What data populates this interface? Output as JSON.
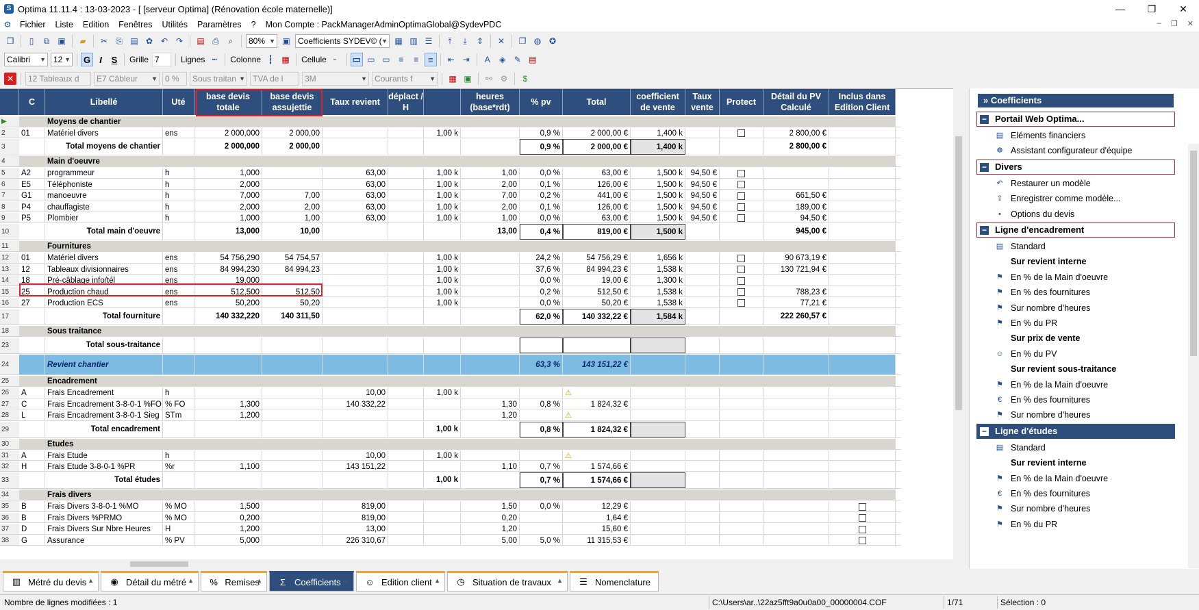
{
  "window": {
    "title": "Optima 11.11.4 : 13-03-2023 - [ [serveur Optima] (Rénovation école maternelle)]",
    "minimize": "—",
    "maximize": "❐",
    "close": "✕"
  },
  "menu": {
    "items": [
      "Fichier",
      "Liste",
      "Edition",
      "Fenêtres",
      "Utilités",
      "Paramètres",
      "?"
    ],
    "account": "Mon Compte : PackManagerAdminOptimaGlobal@SydevPDC",
    "mdi": [
      "–",
      "❐",
      "✕"
    ]
  },
  "toolbar1": {
    "zoom": "80%",
    "coeff_combo": "Coefficients  SYDEV© ("
  },
  "toolbar2": {
    "font": "Calibri",
    "size": "12",
    "bold": "G",
    "italic": "I",
    "strike": "S",
    "grille_label": "Grille",
    "grille_value": "7",
    "lignes_label": "Lignes",
    "colonne_label": "Colonne",
    "cellule_label": "Cellule"
  },
  "toolbar3": {
    "c1": "12  Tableaux d",
    "c2": "E7  Câbleur",
    "c3": "0 %",
    "c4": "Sous traitan",
    "c5": "TVA de l",
    "c6": "3M",
    "c7": "Courants f"
  },
  "columns": [
    {
      "key": "c",
      "label": "C"
    },
    {
      "key": "libelle",
      "label": "Libellé"
    },
    {
      "key": "ute",
      "label": "Uté"
    },
    {
      "key": "bdt",
      "label": "base devis totale"
    },
    {
      "key": "bda",
      "label": "base devis assujettie"
    },
    {
      "key": "tr",
      "label": "Taux revient"
    },
    {
      "key": "dep",
      "label": "déplact / H"
    },
    {
      "key": "k",
      "label": ""
    },
    {
      "key": "h",
      "label": "heures (base*rdt)"
    },
    {
      "key": "pv",
      "label": "% pv"
    },
    {
      "key": "tot",
      "label": "Total"
    },
    {
      "key": "cv",
      "label": "coefficient de vente"
    },
    {
      "key": "tv",
      "label": "Taux vente"
    },
    {
      "key": "prot",
      "label": "Protect"
    },
    {
      "key": "dpv",
      "label": "Détail du PV Calculé"
    },
    {
      "key": "inc",
      "label": "Inclus dans Edition Client"
    }
  ],
  "rows": [
    {
      "n": "",
      "type": "sec",
      "libelle": "Moyens de chantier"
    },
    {
      "n": "2",
      "c": "01",
      "libelle": "Matériel divers",
      "ute": "ens",
      "bdt": "2 000,000",
      "bda": "2 000,00",
      "k": "1,00 k",
      "pv": "0,9 %",
      "tot": "2 000,00 €",
      "cv": "1,400 k",
      "prot": true,
      "dpv": "2 800,00 €"
    },
    {
      "n": "3",
      "type": "tot",
      "libelle": "Total moyens de chantier",
      "bdt": "2 000,000",
      "bda": "2 000,00",
      "pv": "0,9 %",
      "tot": "2 000,00 €",
      "cv": "1,400 k",
      "dpv": "2 800,00 €"
    },
    {
      "n": "4",
      "type": "sec",
      "libelle": "Main d'oeuvre"
    },
    {
      "n": "5",
      "c": "A2",
      "libelle": "programmeur",
      "ute": "h",
      "bdt": "1,000",
      "tr": "63,00",
      "k": "1,00 k",
      "h": "1,00",
      "pv": "0,0 %",
      "tot": "63,00 €",
      "cv": "1,500 k",
      "tv": "94,50 €",
      "prot": true
    },
    {
      "n": "6",
      "c": "E5",
      "libelle": "Téléphoniste",
      "ute": "h",
      "bdt": "2,000",
      "tr": "63,00",
      "k": "1,00 k",
      "h": "2,00",
      "pv": "0,1 %",
      "tot": "126,00 €",
      "cv": "1,500 k",
      "tv": "94,50 €",
      "prot": true
    },
    {
      "n": "7",
      "c": "G1",
      "libelle": "manoeuvre",
      "ute": "h",
      "bdt": "7,000",
      "bda": "7,00",
      "tr": "63,00",
      "k": "1,00 k",
      "h": "7,00",
      "pv": "0,2 %",
      "tot": "441,00 €",
      "cv": "1,500 k",
      "tv": "94,50 €",
      "prot": true,
      "dpv": "661,50 €"
    },
    {
      "n": "8",
      "c": "P4",
      "libelle": "chauffagiste",
      "ute": "h",
      "bdt": "2,000",
      "bda": "2,00",
      "tr": "63,00",
      "k": "1,00 k",
      "h": "2,00",
      "pv": "0,1 %",
      "tot": "126,00 €",
      "cv": "1,500 k",
      "tv": "94,50 €",
      "prot": true,
      "dpv": "189,00 €"
    },
    {
      "n": "9",
      "c": "P5",
      "libelle": "Plombier",
      "ute": "h",
      "bdt": "1,000",
      "bda": "1,00",
      "tr": "63,00",
      "k": "1,00 k",
      "h": "1,00",
      "pv": "0,0 %",
      "tot": "63,00 €",
      "cv": "1,500 k",
      "tv": "94,50 €",
      "prot": true,
      "dpv": "94,50 €"
    },
    {
      "n": "10",
      "type": "tot",
      "libelle": "Total main d'oeuvre",
      "bdt": "13,000",
      "bda": "10,00",
      "h": "13,00",
      "pv": "0,4 %",
      "tot": "819,00 €",
      "cv": "1,500 k",
      "dpv": "945,00 €"
    },
    {
      "n": "11",
      "type": "sec",
      "libelle": "Fournitures"
    },
    {
      "n": "12",
      "c": "01",
      "libelle": "Matériel divers",
      "ute": "ens",
      "bdt": "54 756,290",
      "bda": "54 754,57",
      "k": "1,00 k",
      "pv": "24,2 %",
      "tot": "54 756,29 €",
      "cv": "1,656 k",
      "prot": true,
      "dpv": "90 673,19 €"
    },
    {
      "n": "13",
      "c": "12",
      "libelle": "Tableaux divisionnaires",
      "ute": "ens",
      "bdt": "84 994,230",
      "bda": "84 994,23",
      "k": "1,00 k",
      "pv": "37,6 %",
      "tot": "84 994,23 €",
      "cv": "1,538 k",
      "prot": true,
      "dpv": "130 721,94 €"
    },
    {
      "n": "14",
      "c": "18",
      "libelle": "Pré-câblage info/tél",
      "ute": "ens",
      "bdt": "19,000",
      "k": "1,00 k",
      "pv": "0,0 %",
      "tot": "19,00 €",
      "cv": "1,300 k",
      "prot": true
    },
    {
      "n": "15",
      "c": "25",
      "libelle": "Production chaud",
      "ute": "ens",
      "bdt": "512,500",
      "bda": "512,50",
      "k": "1,00 k",
      "pv": "0,2 %",
      "tot": "512,50 €",
      "cv": "1,538 k",
      "prot": true,
      "dpv": "788,23 €"
    },
    {
      "n": "16",
      "c": "27",
      "libelle": "Production ECS",
      "ute": "ens",
      "bdt": "50,200",
      "bda": "50,20",
      "k": "1,00 k",
      "pv": "0,0 %",
      "tot": "50,20 €",
      "cv": "1,538 k",
      "prot": true,
      "dpv": "77,21 €"
    },
    {
      "n": "17",
      "type": "tot",
      "libelle": "Total fourniture",
      "bdt": "140 332,220",
      "bda": "140 311,50",
      "pv": "62,0 %",
      "tot": "140 332,22 €",
      "cv": "1,584 k",
      "dpv": "222 260,57 €"
    },
    {
      "n": "18",
      "type": "sec",
      "libelle": "Sous traitance"
    },
    {
      "n": "23",
      "type": "tot",
      "libelle": "Total sous-traitance"
    },
    {
      "n": "24",
      "type": "rev",
      "libelle": "Revient chantier",
      "pv": "63,3 %",
      "tot": "143 151,22 €"
    },
    {
      "n": "25",
      "type": "sec",
      "libelle": "Encadrement"
    },
    {
      "n": "26",
      "c": "A",
      "libelle": "Frais Encadrement",
      "ute": "h",
      "tr": "10,00",
      "k": "1,00 k",
      "warn": true
    },
    {
      "n": "27",
      "c": "C",
      "libelle": "Frais Encadrement 3-8-0-1 %FO",
      "ute": "% FO",
      "bdt": "1,300",
      "tr": "140 332,22",
      "h": "1,30",
      "pv": "0,8 %",
      "tot": "1 824,32 €"
    },
    {
      "n": "28",
      "c": "L",
      "libelle": "Frais Encadrement 3-8-0-1 Sieg",
      "ute": "STm",
      "bdt": "1,200",
      "h": "1,20",
      "warn": true
    },
    {
      "n": "29",
      "type": "tot",
      "libelle": "Total encadrement",
      "k": "1,00 k",
      "pv": "0,8 %",
      "tot": "1 824,32 €"
    },
    {
      "n": "30",
      "type": "sec",
      "libelle": "Etudes"
    },
    {
      "n": "31",
      "c": "A",
      "libelle": "Frais Etude",
      "ute": "h",
      "tr": "10,00",
      "k": "1,00 k",
      "warn": true
    },
    {
      "n": "32",
      "c": "H",
      "libelle": "Frais Etude 3-8-0-1 %PR",
      "ute": "%r",
      "bdt": "1,100",
      "tr": "143 151,22",
      "h": "1,10",
      "pv": "0,7 %",
      "tot": "1 574,66 €"
    },
    {
      "n": "33",
      "type": "tot",
      "libelle": "Total études",
      "k": "1,00 k",
      "pv": "0,7 %",
      "tot": "1 574,66 €"
    },
    {
      "n": "34",
      "type": "sec",
      "libelle": "Frais divers"
    },
    {
      "n": "35",
      "c": "B",
      "libelle": "Frais Divers 3-8-0-1 %MO",
      "ute": "% MO",
      "bdt": "1,500",
      "tr": "819,00",
      "h": "1,50",
      "pv": "0,0 %",
      "tot": "12,29 €",
      "inc": true
    },
    {
      "n": "36",
      "c": "B",
      "libelle": "Frais Divers %PRMO",
      "ute": "% MO",
      "bdt": "0,200",
      "tr": "819,00",
      "h": "0,20",
      "tot": "1,64 €",
      "inc": true
    },
    {
      "n": "37",
      "c": "D",
      "libelle": "Frais Divers Sur Nbre Heures",
      "ute": "H",
      "bdt": "1,200",
      "tr": "13,00",
      "h": "1,20",
      "tot": "15,60 €",
      "inc": true
    },
    {
      "n": "38",
      "c": "G",
      "libelle": "Assurance",
      "ute": "% PV",
      "bdt": "5,000",
      "tr": "226 310,67",
      "h": "5,00",
      "pv": "5,0 %",
      "tot": "11 315,53 €",
      "inc": true
    }
  ],
  "panel": {
    "title": "Coefficients",
    "groups": [
      {
        "label": "Portail Web Optima...",
        "items": [
          {
            "icon": "coins-icon",
            "glyph": "▤",
            "label": "Eléments financiers"
          },
          {
            "icon": "team-icon",
            "glyph": "☸",
            "label": "Assistant configurateur d'équipe"
          }
        ]
      },
      {
        "label": "Divers",
        "items": [
          {
            "icon": "restore-icon",
            "glyph": "↶",
            "label": "Restaurer un modèle"
          },
          {
            "icon": "save-model-icon",
            "glyph": "⇪",
            "label": "Enregistrer comme modèle..."
          },
          {
            "icon": "options-icon",
            "glyph": "•",
            "label": "Options du devis"
          }
        ]
      },
      {
        "label": "Ligne d'encadrement",
        "items": [
          {
            "icon": "standard-icon",
            "glyph": "▤",
            "label": "Standard"
          },
          {
            "icon": "",
            "glyph": "",
            "label": "Sur revient interne",
            "bold": true
          },
          {
            "icon": "worker-icon",
            "glyph": "⚑",
            "label": "En % de la Main d'oeuvre"
          },
          {
            "icon": "worker-icon",
            "glyph": "⚑",
            "label": "En % des fournitures"
          },
          {
            "icon": "worker-icon",
            "glyph": "⚑",
            "label": "Sur nombre d'heures"
          },
          {
            "icon": "worker-icon",
            "glyph": "⚑",
            "label": "En % du PR"
          },
          {
            "icon": "",
            "glyph": "",
            "label": "Sur prix de vente",
            "bold": true
          },
          {
            "icon": "person-icon",
            "glyph": "☺",
            "label": "En % du PV"
          },
          {
            "icon": "",
            "glyph": "",
            "label": "Sur revient sous-traitance",
            "bold": true
          },
          {
            "icon": "worker-icon",
            "glyph": "⚑",
            "label": "En % de la Main d'oeuvre"
          },
          {
            "icon": "euro-icon",
            "glyph": "€",
            "label": "En % des fournitures"
          },
          {
            "icon": "worker-icon",
            "glyph": "⚑",
            "label": "Sur nombre d'heures"
          }
        ]
      },
      {
        "label": "Ligne d'études",
        "selected": true,
        "items": [
          {
            "icon": "standard-icon",
            "glyph": "▤",
            "label": "Standard"
          },
          {
            "icon": "",
            "glyph": "",
            "label": "Sur revient interne",
            "bold": true
          },
          {
            "icon": "worker-icon",
            "glyph": "⚑",
            "label": "En % de la Main d'oeuvre"
          },
          {
            "icon": "euro-icon",
            "glyph": "€",
            "label": "En % des fournitures"
          },
          {
            "icon": "worker-icon",
            "glyph": "⚑",
            "label": "Sur nombre d'heures"
          },
          {
            "icon": "worker-icon",
            "glyph": "⚑",
            "label": "En % du PR"
          }
        ]
      }
    ]
  },
  "tabs": [
    {
      "icon": "document-icon",
      "glyph": "▥",
      "label": "Métré du devis"
    },
    {
      "icon": "eye-icon",
      "glyph": "◉",
      "label": "Détail du métré"
    },
    {
      "icon": "percent-icon",
      "glyph": "%",
      "label": "Remises"
    },
    {
      "icon": "sigma-icon",
      "glyph": "Σ",
      "label": "Coefficients",
      "active": true
    },
    {
      "icon": "user-icon",
      "glyph": "☺",
      "label": "Edition client"
    },
    {
      "icon": "clock-icon",
      "glyph": "◷",
      "label": "Situation de travaux"
    },
    {
      "icon": "list-icon",
      "glyph": "☰",
      "label": "Nomenclature"
    }
  ],
  "status": {
    "left": "Nombre de lignes modifiées : 1",
    "path": "C:\\Users\\ar..\\22az5fft9a0u0a00_00000004.COF",
    "page": "1/71",
    "selection": "Sélection : 0"
  }
}
